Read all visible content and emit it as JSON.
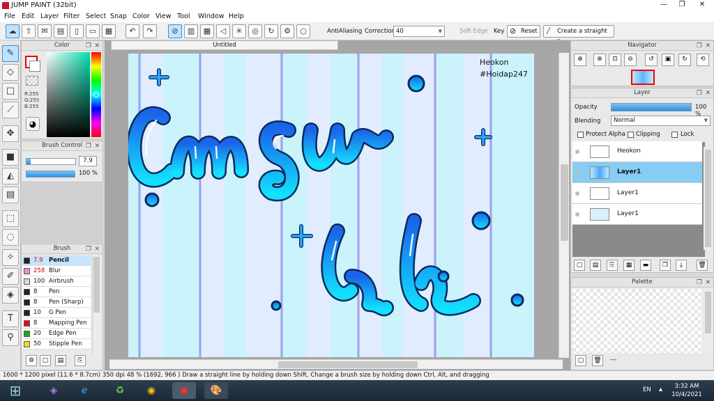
{
  "app": {
    "title": "JUMP PAINT (32bit)",
    "win_min": "—",
    "win_max": "❐",
    "win_close": "✕"
  },
  "menu": [
    "File",
    "Edit",
    "Layer",
    "Filter",
    "Select",
    "Snap",
    "Color",
    "View",
    "Tool",
    "Window",
    "Help"
  ],
  "toolbar": {
    "antialiasing": "AntiAliasing",
    "correction_label": "Correction",
    "correction_value": "40",
    "soft_edge": "Soft Edge",
    "key": "Key",
    "reset": "Reset",
    "straight_line": "Create a straight line"
  },
  "color_panel": {
    "title": "Color",
    "r": "R:255",
    "g": "G:255",
    "b": "B:255"
  },
  "brush_control": {
    "title": "Brush Control",
    "size": "7.9",
    "opacity": "100 %"
  },
  "brush_panel": {
    "title": "Brush",
    "items": [
      {
        "size": "7.9",
        "name": "Pencil",
        "color": "#222222"
      },
      {
        "size": "258",
        "name": "Blur",
        "color": "#f08ae0"
      },
      {
        "size": "100",
        "name": "Airbrush",
        "color": "#d8d8d8"
      },
      {
        "size": "8",
        "name": "Pen",
        "color": "#222222"
      },
      {
        "size": "8",
        "name": "Pen (Sharp)",
        "color": "#222222"
      },
      {
        "size": "10",
        "name": "G Pen",
        "color": "#222222"
      },
      {
        "size": "8",
        "name": "Mapping Pen",
        "color": "#e01010"
      },
      {
        "size": "20",
        "name": "Edge Pen",
        "color": "#10b010"
      },
      {
        "size": "50",
        "name": "Stipple Pen",
        "color": "#e8e020"
      }
    ]
  },
  "canvas": {
    "tab": "Untitled",
    "signature_line1": "Heokon",
    "signature_line2": "#Hoidap247",
    "art_line1": "Cmsn",
    "art_line2": "khi"
  },
  "navigator": {
    "title": "Navigator"
  },
  "layer_panel": {
    "title": "Layer",
    "opacity_label": "Opacity",
    "opacity_value": "100 %",
    "blending_label": "Blending",
    "blending_value": "Normal",
    "protect_alpha": "Protect Alpha",
    "clipping": "Clipping",
    "lock": "Lock",
    "layers": [
      {
        "name": "Heokon"
      },
      {
        "name": "Layer1"
      },
      {
        "name": "Layer1"
      },
      {
        "name": "Layer1"
      }
    ],
    "dash": "---"
  },
  "palette": {
    "title": "Palette",
    "dash": "---"
  },
  "status": {
    "text": "1600 * 1200 pixel   (11.6 * 8.7cm)   350 dpi   48 %   (1692, 966 )   Draw a straight line by holding down Shift, Change a brush size by holding down Ctrl, Alt, and dragging"
  },
  "taskbar": {
    "lang": "EN",
    "time": "3:32 AM",
    "date": "10/4/2021"
  },
  "colors": {
    "accent": "#3b8ed6",
    "cyan": "#00aaff",
    "selected_row": "#86ccf4"
  }
}
